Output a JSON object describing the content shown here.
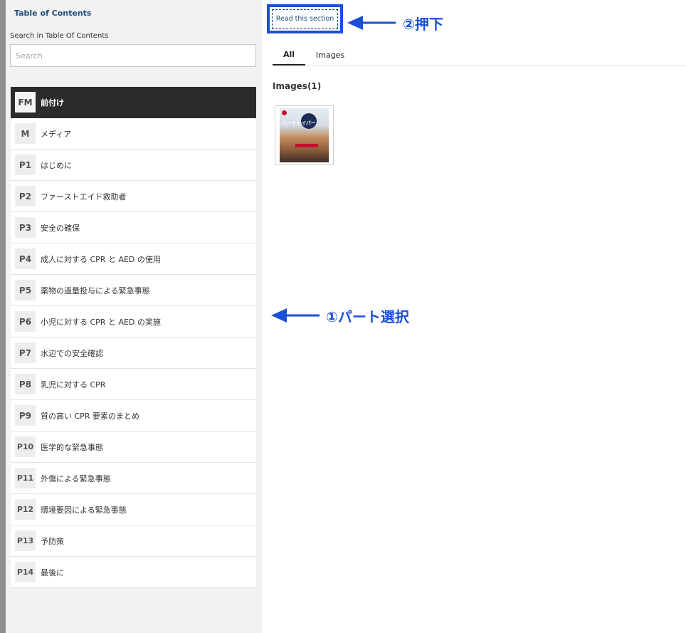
{
  "sidebar": {
    "title": "Table of Contents",
    "search_label": "Search in Table Of Contents",
    "search_placeholder": "Search",
    "items": [
      {
        "code": "FM",
        "label": "前付け"
      },
      {
        "code": "M",
        "label": "メディア"
      },
      {
        "code": "P1",
        "label": "はじめに"
      },
      {
        "code": "P2",
        "label": "ファーストエイド救助者"
      },
      {
        "code": "P3",
        "label": "安全の確保"
      },
      {
        "code": "P4",
        "label": "成人に対する CPR と AED の使用"
      },
      {
        "code": "P5",
        "label": "薬物の過量投与による緊急事態"
      },
      {
        "code": "P6",
        "label": "小児に対する CPR と AED の実施"
      },
      {
        "code": "P7",
        "label": "水辺での安全確認"
      },
      {
        "code": "P8",
        "label": "乳児に対する CPR"
      },
      {
        "code": "P9",
        "label": "質の高い CPR 要素のまとめ"
      },
      {
        "code": "P10",
        "label": "医学的な緊急事態"
      },
      {
        "code": "P11",
        "label": "外傷による緊急事態"
      },
      {
        "code": "P12",
        "label": "環境要因による緊急事態"
      },
      {
        "code": "P13",
        "label": "予防策"
      },
      {
        "code": "P14",
        "label": "最後に"
      }
    ]
  },
  "main": {
    "read_button": "Read this section",
    "tabs": [
      {
        "label": "All"
      },
      {
        "label": "Images"
      }
    ],
    "images_heading": "Images(1)",
    "thumbnail": {
      "cover_title": "ハートセイバー"
    }
  },
  "annotations": {
    "step1": "①パート選択",
    "step2": "②押下"
  },
  "colors": {
    "accent": "#1a4fd8",
    "active_item_bg": "#2b2b2b",
    "toc_title": "#1f4e79"
  }
}
